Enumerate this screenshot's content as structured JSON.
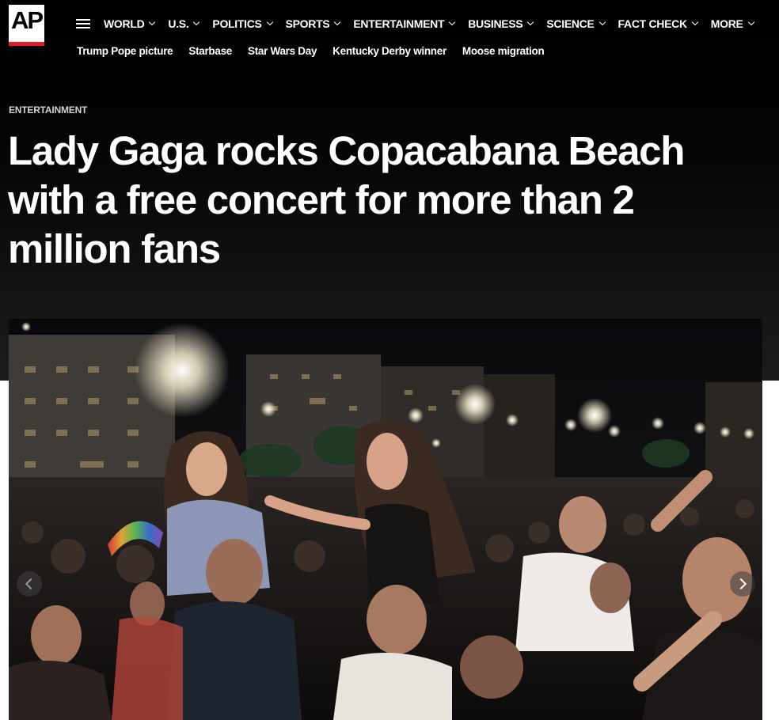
{
  "brand": {
    "logo_text": "AP",
    "accent_color": "#e41d24"
  },
  "nav": {
    "menu_icon": "hamburger-icon",
    "items": [
      {
        "label": "WORLD"
      },
      {
        "label": "U.S."
      },
      {
        "label": "POLITICS"
      },
      {
        "label": "SPORTS"
      },
      {
        "label": "ENTERTAINMENT"
      },
      {
        "label": "BUSINESS"
      },
      {
        "label": "SCIENCE"
      },
      {
        "label": "FACT CHECK"
      },
      {
        "label": "MORE"
      }
    ]
  },
  "trending": [
    "Trump Pope picture",
    "Starbase",
    "Star Wars Day",
    "Kentucky Derby winner",
    "Moose migration"
  ],
  "article": {
    "section": "ENTERTAINMENT",
    "headline": "Lady Gaga rocks Copacabana Beach with a free concert for more than 2 million fans"
  },
  "gallery": {
    "prev_icon": "chevron-left-icon",
    "next_icon": "chevron-right-icon"
  }
}
